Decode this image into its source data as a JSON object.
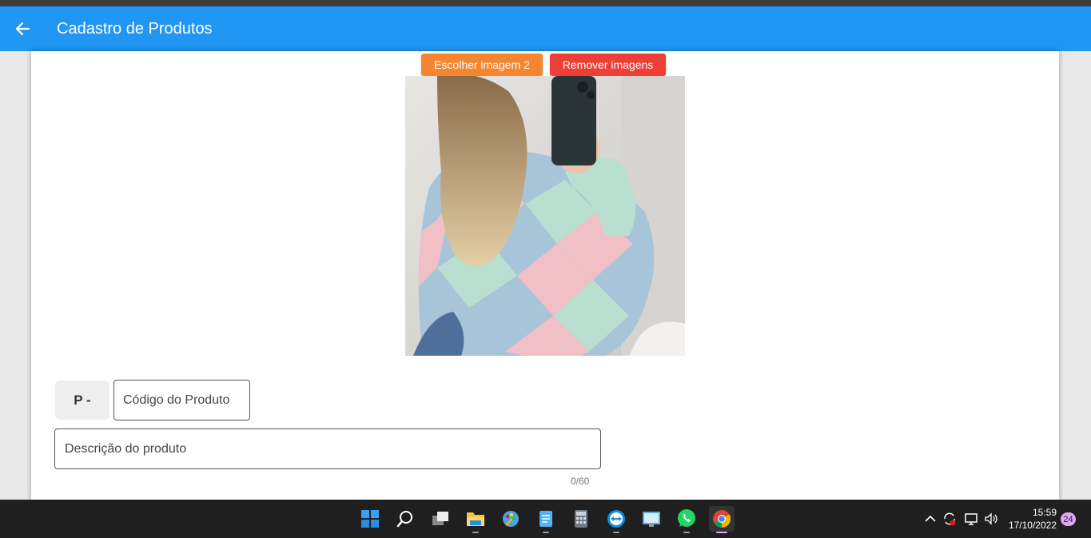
{
  "appbar": {
    "title": "Cadastro de Produtos"
  },
  "buttons": {
    "choose_image": "Escolher imagem 2",
    "remove_images": "Remover imagens"
  },
  "form": {
    "code_prefix": "P -",
    "code_placeholder": "Código do Produto",
    "description_placeholder": "Descrição do produto",
    "description_counter": "0/60"
  },
  "taskbar": {
    "apps": [
      "start",
      "search",
      "task-view",
      "file-explorer",
      "paint",
      "notepad",
      "calculator",
      "teamviewer",
      "remote-desktop",
      "whatsapp",
      "chrome"
    ],
    "time": "15:59",
    "date": "17/10/2022",
    "notification_count": "24"
  },
  "colors": {
    "appbar": "#2196f3",
    "choose_button": "#f5852e",
    "remove_button": "#ef3e36",
    "taskbar": "#1f1f1f"
  }
}
